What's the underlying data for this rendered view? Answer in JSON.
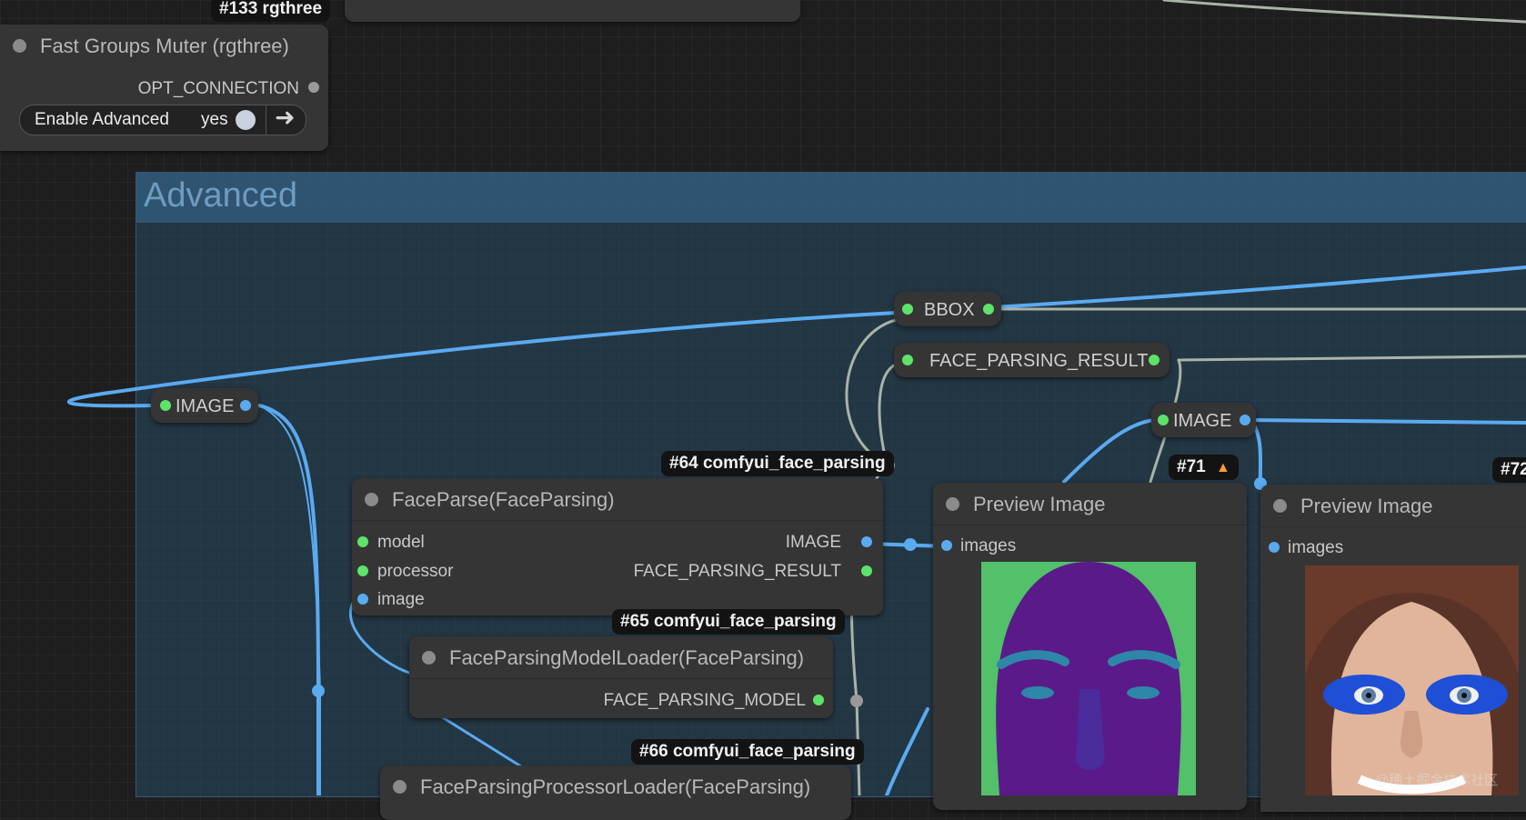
{
  "colors": {
    "image_socket": "#5aaaf0",
    "data_socket": "#5de36a",
    "group_fill": "#284a62",
    "badge_bg": "#131313"
  },
  "badges": {
    "rgthree": "#133 rgthree",
    "face_parsing_64": "#64 comfyui_face_parsing",
    "face_parsing_65": "#65 comfyui_face_parsing",
    "face_parsing_66": "#66 comfyui_face_parsing",
    "n71": "#71",
    "n72": "#72"
  },
  "badge_icon": "fox-icon",
  "muter": {
    "title": "Fast Groups Muter (rgthree)",
    "output": "OPT_CONNECTION",
    "toggle_label": "Enable Advanced",
    "toggle_value": "yes"
  },
  "group": {
    "title": "Advanced"
  },
  "reroutes": {
    "bbox": "BBOX",
    "face_result": "FACE_PARSING_RESULT",
    "image_left": "IMAGE",
    "image_right": "IMAGE"
  },
  "face_parse": {
    "title": "FaceParse(FaceParsing)",
    "inputs": [
      "model",
      "processor",
      "image"
    ],
    "outputs": [
      "IMAGE",
      "FACE_PARSING_RESULT"
    ]
  },
  "model_loader": {
    "title": "FaceParsingModelLoader(FaceParsing)",
    "output": "FACE_PARSING_MODEL"
  },
  "processor_loader": {
    "title": "FaceParsingProcessorLoader(FaceParsing)"
  },
  "preview1": {
    "title": "Preview Image",
    "input": "images"
  },
  "preview2": {
    "title": "Preview Image",
    "input": "images"
  },
  "watermark": "@稀土掘金技术社区"
}
